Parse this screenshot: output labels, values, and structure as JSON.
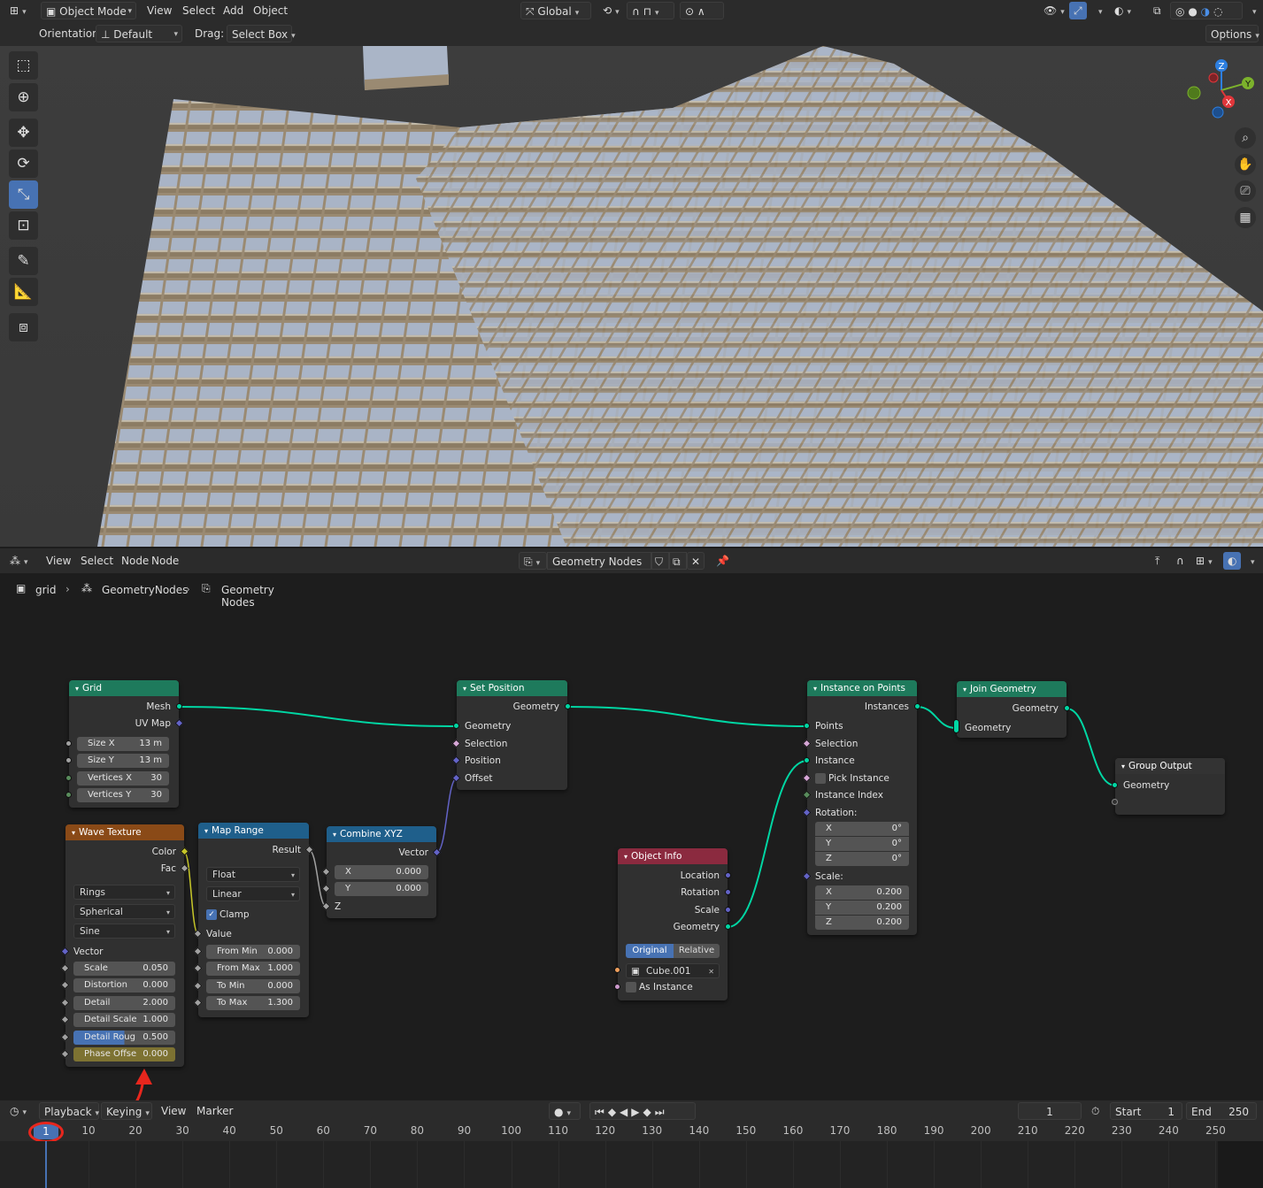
{
  "viewport_header": {
    "editor_icon": "mesh-cube-icon",
    "mode": "Object Mode",
    "menus": [
      "View",
      "Select",
      "Add",
      "Object"
    ],
    "transform_orientation": "Global"
  },
  "viewport_toolbar": {
    "orientation_label": "Orientation:",
    "orientation_value": "Default",
    "drag_label": "Drag:",
    "drag_value": "Select Box",
    "options": "Options"
  },
  "tools": [
    "select-box-icon",
    "cursor-icon",
    "move-icon",
    "rotate-icon",
    "scale-icon",
    "transform-icon",
    "annotate-icon",
    "measure-icon",
    "add-cube-icon"
  ],
  "gizmo": {
    "z": "Z",
    "y": "Y",
    "x": "X"
  },
  "viewport_nav": [
    "zoom-icon",
    "hand-icon",
    "camera-icon",
    "grid-icon"
  ],
  "node_editor_header": {
    "menus": [
      "View",
      "Select",
      "Node"
    ],
    "node_group": "Geometry Nodes"
  },
  "breadcrumbs": [
    "grid",
    "GeometryNodes",
    "Geometry Nodes"
  ],
  "nodes": {
    "grid": {
      "title": "Grid",
      "out_mesh": "Mesh",
      "out_uv": "UV Map",
      "size_x_label": "Size X",
      "size_x": "13 m",
      "size_y_label": "Size Y",
      "size_y": "13 m",
      "vx_label": "Vertices X",
      "vx": "30",
      "vy_label": "Vertices Y",
      "vy": "30"
    },
    "wave": {
      "title": "Wave Texture",
      "out_color": "Color",
      "out_fac": "Fac",
      "type": "Rings",
      "direction": "Spherical",
      "profile": "Sine",
      "in_vector": "Vector",
      "scale_label": "Scale",
      "scale": "0.050",
      "distortion_label": "Distortion",
      "distortion": "0.000",
      "detail_label": "Detail",
      "detail": "2.000",
      "detail_scale_label": "Detail Scale",
      "detail_scale": "1.000",
      "detail_rough_label": "Detail Roug",
      "detail_rough": "0.500",
      "phase_label": "Phase Offse",
      "phase": "0.000"
    },
    "map_range": {
      "title": "Map Range",
      "out_result": "Result",
      "data_type": "Float",
      "interp": "Linear",
      "clamp": "Clamp",
      "in_value": "Value",
      "from_min_label": "From Min",
      "from_min": "0.000",
      "from_max_label": "From Max",
      "from_max": "1.000",
      "to_min_label": "To Min",
      "to_min": "0.000",
      "to_max_label": "To Max",
      "to_max": "1.300"
    },
    "combine": {
      "title": "Combine XYZ",
      "out_vector": "Vector",
      "x_label": "X",
      "x": "0.000",
      "y_label": "Y",
      "y": "0.000",
      "z_label": "Z"
    },
    "set_pos": {
      "title": "Set Position",
      "out_geometry": "Geometry",
      "in_geometry": "Geometry",
      "in_selection": "Selection",
      "in_position": "Position",
      "in_offset": "Offset"
    },
    "object_info": {
      "title": "Object Info",
      "out_location": "Location",
      "out_rotation": "Rotation",
      "out_scale": "Scale",
      "out_geometry": "Geometry",
      "original": "Original",
      "relative": "Relative",
      "object": "Cube.001",
      "as_instance": "As Instance"
    },
    "iop": {
      "title": "Instance on Points",
      "out_instances": "Instances",
      "in_points": "Points",
      "in_selection": "Selection",
      "in_instance": "Instance",
      "pick_instance": "Pick Instance",
      "instance_index": "Instance Index",
      "rotation_label": "Rotation:",
      "rx": "0°",
      "ry": "0°",
      "rz": "0°",
      "scale_label": "Scale:",
      "sx": "0.200",
      "sy": "0.200",
      "sz": "0.200",
      "x": "X",
      "y": "Y",
      "z": "Z"
    },
    "join": {
      "title": "Join Geometry",
      "out_geometry": "Geometry",
      "in_geometry": "Geometry"
    },
    "group_output": {
      "title": "Group Output",
      "in_geometry": "Geometry"
    }
  },
  "timeline": {
    "menus": [
      "Playback",
      "Keying",
      "View",
      "Marker"
    ],
    "current_frame": "1",
    "start_label": "Start",
    "start": "1",
    "end_label": "End",
    "end": "250",
    "ruler": [
      "1",
      "10",
      "20",
      "30",
      "40",
      "50",
      "60",
      "70",
      "80",
      "90",
      "100",
      "110",
      "120",
      "130",
      "140",
      "150",
      "160",
      "170",
      "180",
      "190",
      "200",
      "210",
      "220",
      "230",
      "240",
      "250"
    ]
  },
  "colors": {
    "geometry_socket": "#00d6a3",
    "vector_socket": "#6363c7",
    "float_socket": "#a1a1a1",
    "color_socket": "#c7c729",
    "annotation_red": "#e8261d",
    "grid_header": "#1e7a5c",
    "texture_header": "#8a4a17",
    "converter_header": "#1f5f8b",
    "input_header": "#8b2a3f",
    "output_header": "#333333"
  }
}
